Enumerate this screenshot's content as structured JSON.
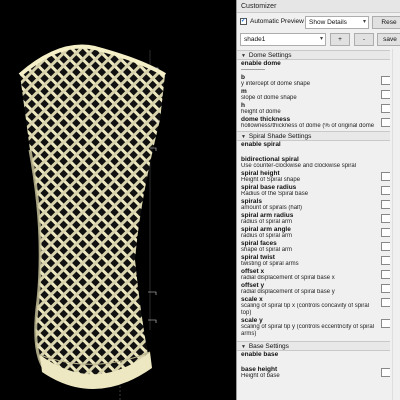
{
  "window": {
    "title": "Customizer"
  },
  "toolbar": {
    "automatic_preview_label": "Automatic Preview",
    "automatic_preview_checked": true,
    "show_details_value": "Show Details",
    "reset_label": "Rese",
    "preset_value": "shade1",
    "add_label": "+",
    "remove_label": "-",
    "save_label": "save"
  },
  "groups": [
    {
      "title": "Dome Settings",
      "params": [
        {
          "name": "enable dome",
          "desc": "------------"
        },
        {
          "name": "b",
          "desc": "y intercept of dome shape"
        },
        {
          "name": "m",
          "desc": "slope of dome shape"
        },
        {
          "name": "h",
          "desc": "height of dome"
        },
        {
          "name": "dome thickness",
          "desc": "hollowness/thickness of dome (% of original dome size)"
        }
      ]
    },
    {
      "title": "Spiral Shade Settings",
      "params": [
        {
          "name": "enable spiral",
          "desc": ""
        },
        {
          "name": "bidirectional spiral",
          "desc": "Use counter-clockwise and clockwise spiral"
        },
        {
          "name": "spiral height",
          "desc": "Height of Spiral shape"
        },
        {
          "name": "spiral base radius",
          "desc": "Radius of the Spiral base"
        },
        {
          "name": "spirals",
          "desc": "amount of spirals (half)"
        },
        {
          "name": "spiral arm radius",
          "desc": "radius of spiral arm"
        },
        {
          "name": "spiral arm angle",
          "desc": "radius of spiral arm"
        },
        {
          "name": "spiral faces",
          "desc": "shape of spiral arm"
        },
        {
          "name": "spiral twist",
          "desc": "twisting of spiral arms"
        },
        {
          "name": "offset x",
          "desc": "radial displacement of spiral base x"
        },
        {
          "name": "offset y",
          "desc": "radial displacement of spiral base y"
        },
        {
          "name": "scale x",
          "desc": "scaling of spiral tip x (controls concavity of spiral top)"
        },
        {
          "name": "scale y",
          "desc": "scaling of spiral tip y (controls eccentricity of spiral arms)"
        }
      ]
    },
    {
      "title": "Base Settings",
      "params": [
        {
          "name": "enable base",
          "desc": ""
        },
        {
          "name": "base height",
          "desc": "Height of base"
        }
      ]
    }
  ],
  "viewport": {
    "background": "#000000",
    "model_color": "#f5f0c8",
    "model_shadow": "#c9c49a",
    "inner_highlight": "#22b8c8"
  }
}
